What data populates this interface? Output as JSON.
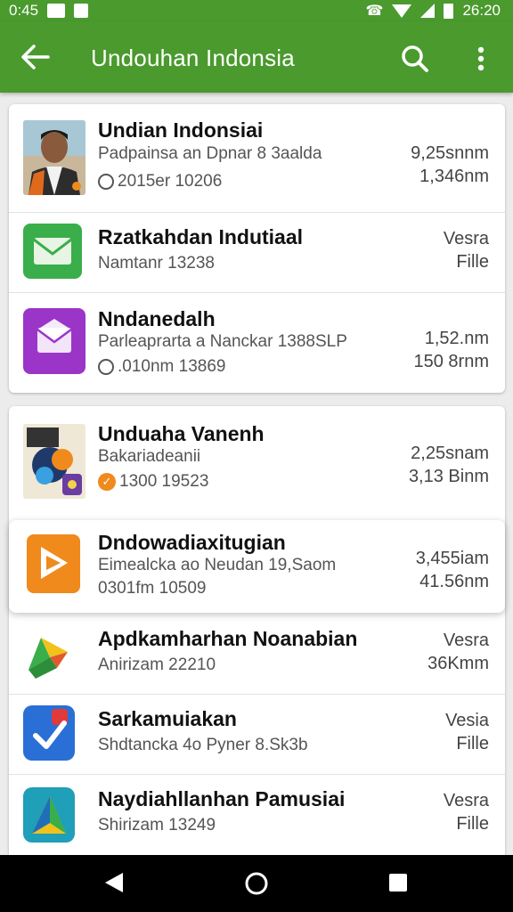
{
  "status_bar": {
    "time_left": "0:45",
    "time_right": "26:20"
  },
  "app_bar": {
    "title": "Undouhan Indonsia",
    "icons": [
      "back-arrow-icon",
      "search-icon",
      "more-vert-icon"
    ]
  },
  "colors": {
    "primary": "#4a9a2e",
    "orange": "#f08a1c",
    "green_mail": "#3aae4a",
    "purple": "#9b35c8"
  },
  "card1": {
    "items": [
      {
        "title": "Undian Indonsiai",
        "subtitle": "Padpainsa an Dpnar 8 3aalda",
        "meta": "2015er 10206",
        "right1": "9,25snnm",
        "right2": "1,346nm"
      },
      {
        "title": "Rzatkahdan Indutiaal",
        "subtitle": "Namtanr 13238",
        "right1": "Vesra",
        "right2": "Fille"
      },
      {
        "title": "Nndanedalh",
        "subtitle": "Parleaprarta a Nanckar 1388SLP",
        "meta": ".010nm 13869",
        "right1": "1,52.nm",
        "right2": "150 8rnm"
      }
    ]
  },
  "card2": {
    "items": [
      {
        "title": "Unduaha Vanenh",
        "subtitle": "Bakariadeanii",
        "meta": "1300 19523",
        "right1": "2,25snam",
        "right2": "3,13 Binm"
      },
      {
        "title": "Dndowadiaxitugian",
        "subtitle": "Eimealcka ao Neudan 19,Saom",
        "meta": "0301fm 10509",
        "right1": "3,455iam",
        "right2": "41.56nm"
      },
      {
        "title": "Apdkamharhan Noanabian",
        "subtitle": "Anirizam 22210",
        "right1": "Vesra",
        "right2": "36Kmm"
      },
      {
        "title": "Sarkamuiakan",
        "subtitle": "Shdtancka 4o Pyner 8.Sk3b",
        "right1": "Vesia",
        "right2": "Fille"
      },
      {
        "title": "Naydiahllanhan Pamusiai",
        "subtitle": "Shirizam 13249",
        "right1": "Vesra",
        "right2": "Fille"
      }
    ]
  }
}
